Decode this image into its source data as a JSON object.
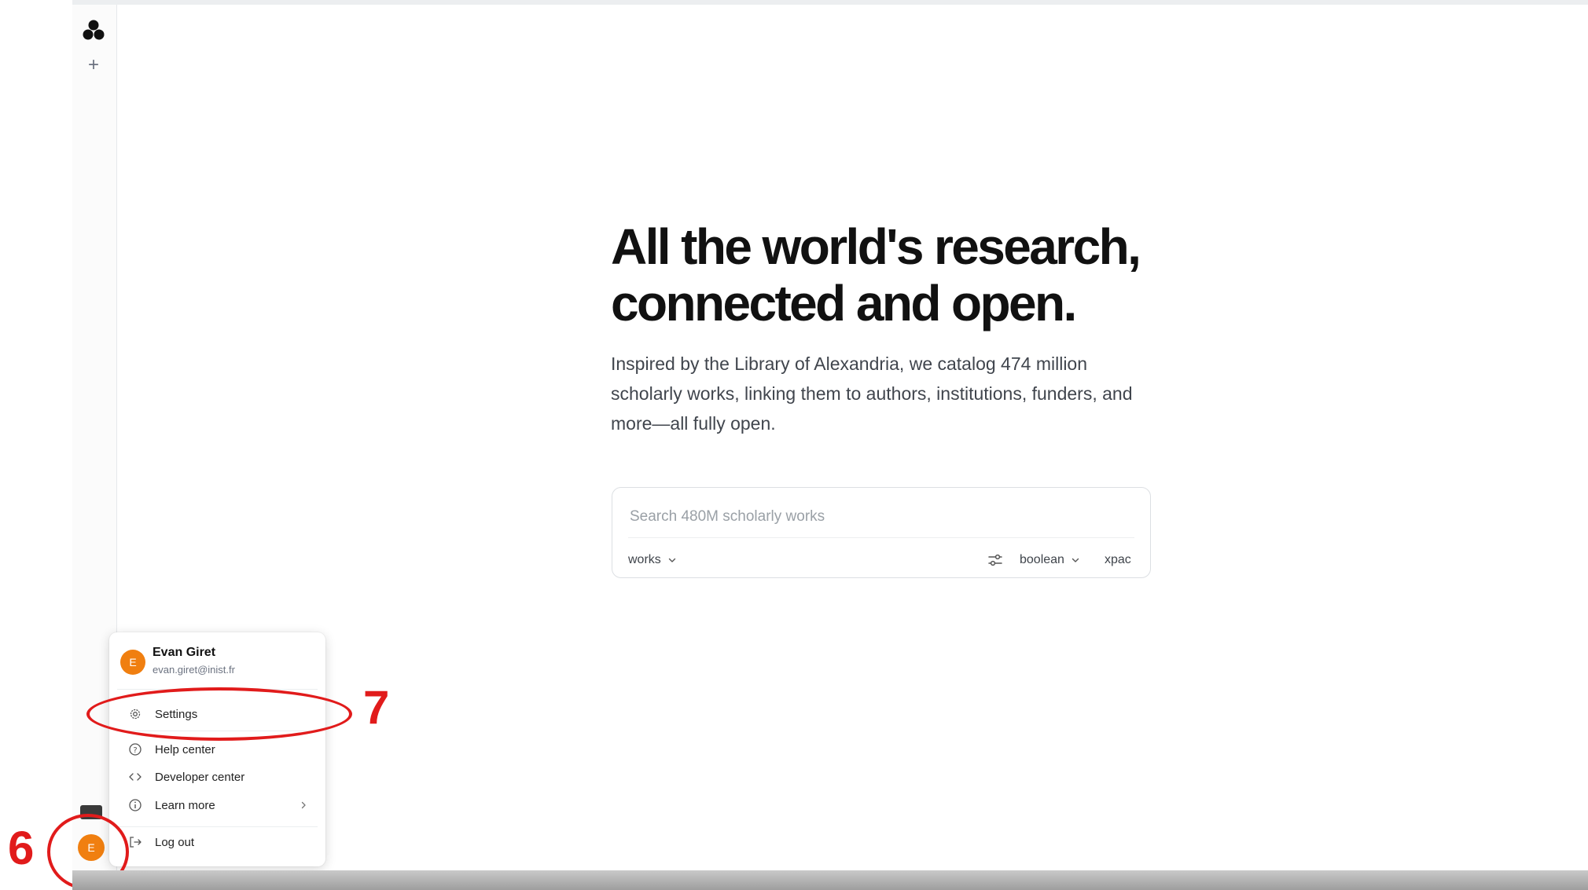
{
  "hero": {
    "headline_line1": "All the world's research,",
    "headline_line2": "connected and open.",
    "intro": "Inspired by the Library of Alexandria, we catalog 474 million scholarly works, linking them to authors, institutions, funders, and more—all fully open."
  },
  "search": {
    "placeholder": "Search 480M scholarly works",
    "value": "",
    "entity_selector": "works",
    "query_mode": "boolean",
    "xpac_label": "xpac"
  },
  "sidebar": {
    "new_label": "+",
    "avatar_initial": "E"
  },
  "user_menu": {
    "avatar_initial": "E",
    "name": "Evan Giret",
    "email": "evan.giret@inist.fr",
    "items": [
      {
        "label": "Settings",
        "icon": "gear-icon"
      },
      {
        "label": "Help center",
        "icon": "help-circle-icon"
      },
      {
        "label": "Developer center",
        "icon": "code-icon"
      },
      {
        "label": "Learn more",
        "icon": "info-icon",
        "has_submenu": true
      },
      {
        "label": "Log out",
        "icon": "logout-icon"
      }
    ]
  },
  "annotations": {
    "marker_avatar": "6",
    "marker_settings": "7",
    "color": "#e11b1b"
  },
  "colors": {
    "avatar": "#f07f10",
    "annotation": "#e11b1b"
  }
}
